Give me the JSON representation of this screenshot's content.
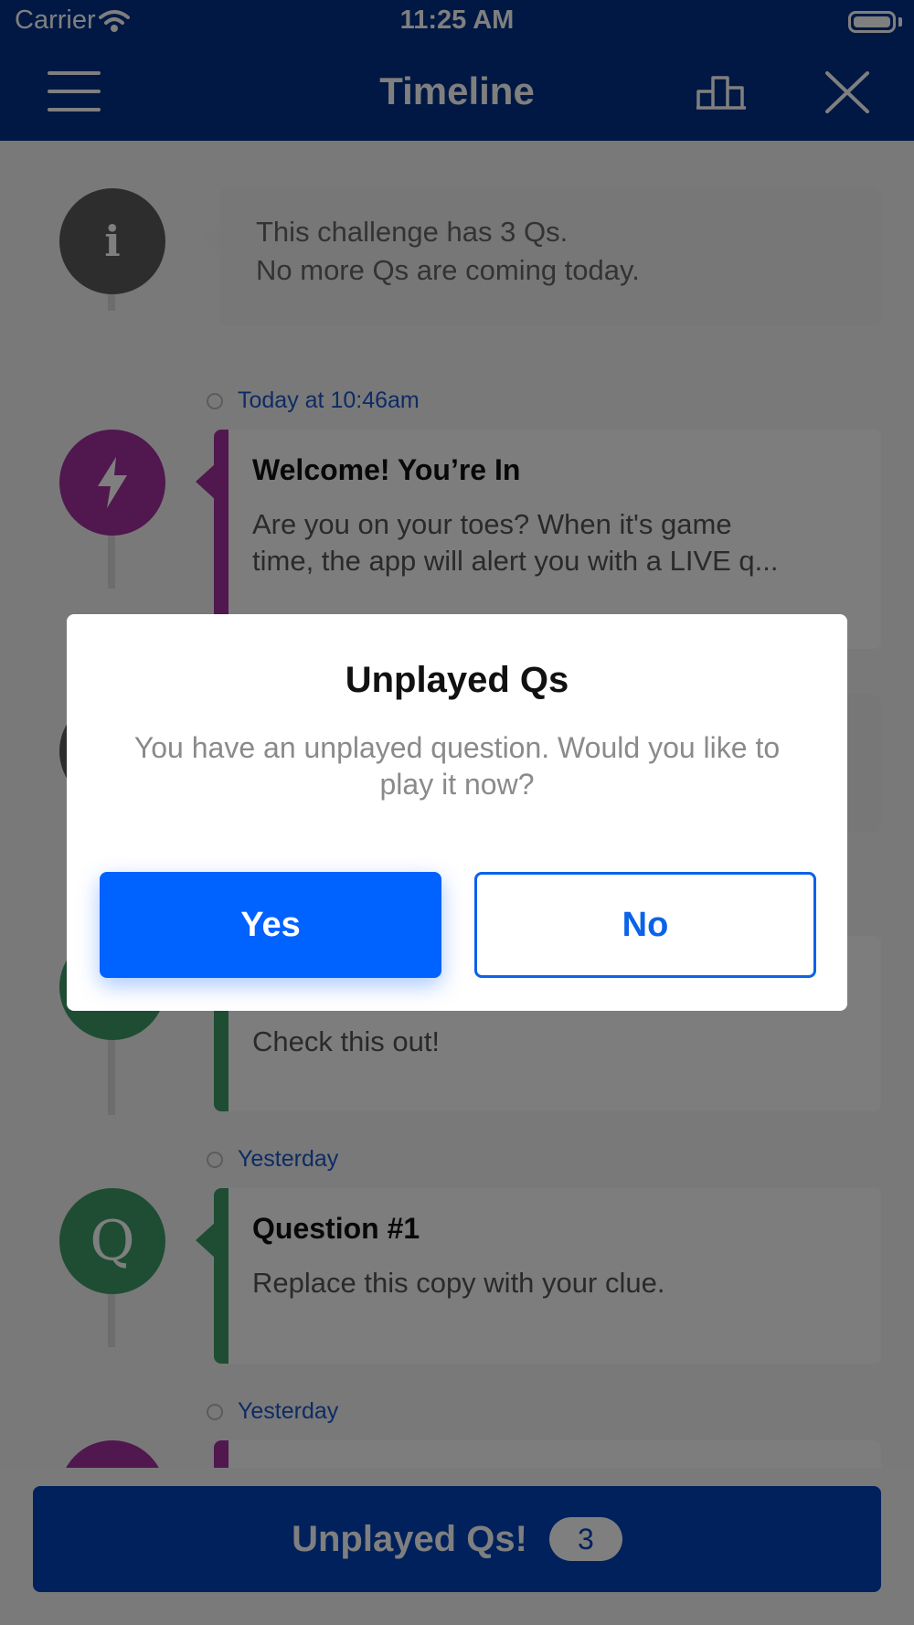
{
  "status": {
    "carrier": "Carrier",
    "time": "11:25 AM"
  },
  "nav": {
    "title": "Timeline",
    "menu_icon": "hamburger-menu-icon",
    "leaderboard_icon": "leaderboard-icon",
    "close_icon": "close-icon"
  },
  "timeline": {
    "info_card": {
      "icon_letter": "i",
      "line1": "This challenge has 3 Qs.",
      "line2": "No more Qs are coming today."
    },
    "items": [
      {
        "stamp": "Today at 10:46am",
        "title": "Welcome! You’re In",
        "body1": "Are you on your toes? When it's game",
        "body2": "time, the app will alert you with a LIVE q...",
        "accent": "#a0309e"
      },
      {
        "stamp": "",
        "title": "",
        "body1": "Check this out!",
        "body2": "",
        "accent": "#3c9a66"
      },
      {
        "stamp": "Yesterday",
        "title": "Question #1",
        "body1": "Replace this copy with your clue.",
        "body2": "",
        "accent": "#3c9a66",
        "icon_letter": "Q"
      },
      {
        "stamp": "Yesterday",
        "title": "",
        "accent": "#a0309e"
      }
    ]
  },
  "dialog": {
    "title": "Unplayed Qs",
    "message": "You have an unplayed question. Would you like to play it now?",
    "yes_label": "Yes",
    "no_label": "No"
  },
  "bottom": {
    "label": "Unplayed Qs!",
    "count": "3"
  },
  "colors": {
    "brand": "#003087",
    "primary_button": "#0062ff",
    "purple": "#a0309e",
    "green": "#3c9a66"
  }
}
